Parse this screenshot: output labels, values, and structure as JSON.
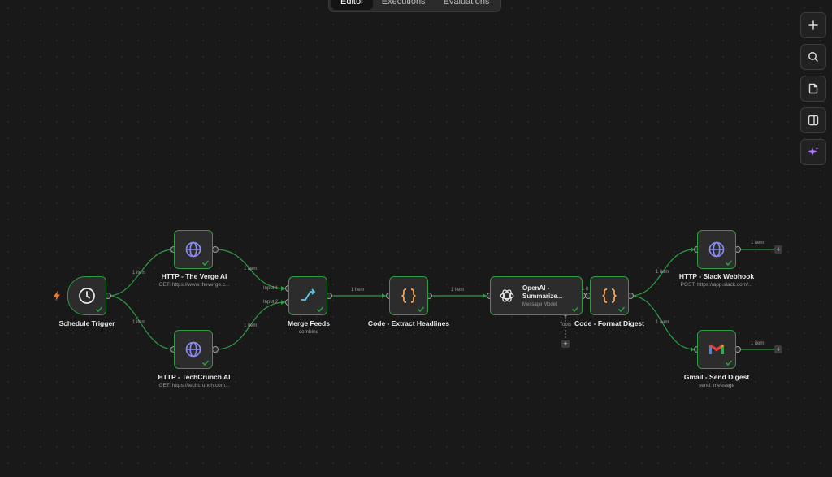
{
  "tabs": [
    {
      "label": "Editor",
      "active": true
    },
    {
      "label": "Executions",
      "active": false
    },
    {
      "label": "Evaluations",
      "active": false
    }
  ],
  "toolbar": [
    "plus-icon",
    "search-icon",
    "sticky-note-icon",
    "panel-icon",
    "ai-sparkle-icon"
  ],
  "nodes": {
    "schedule": {
      "title": "Schedule Trigger"
    },
    "verge": {
      "title": "HTTP - The Verge AI",
      "subtitle": "GET: https://www.theverge.c..."
    },
    "techcrunch": {
      "title": "HTTP - TechCrunch AI",
      "subtitle": "GET: https://techcrunch.com..."
    },
    "merge": {
      "title": "Merge Feeds",
      "subtitle": "combine",
      "input1": "Input 1",
      "input2": "Input 2"
    },
    "extract": {
      "title": "Code - Extract Headlines"
    },
    "openai": {
      "title": "OpenAI - Summarize...",
      "subtitle": "Message Model",
      "tools": "Tools"
    },
    "format": {
      "title": "Code - Format Digest"
    },
    "slack": {
      "title": "HTTP - Slack Webhook",
      "subtitle": "POST: https://app.slack.com/..."
    },
    "gmail": {
      "title": "Gmail - Send Digest",
      "subtitle": "send: message"
    }
  },
  "edges": {
    "item_label": "1 item"
  },
  "colors": {
    "success": "#2f9a44",
    "background": "#191919",
    "node": "#2c2c2c",
    "accent": "#f47a27",
    "ai": "#b57bff"
  }
}
